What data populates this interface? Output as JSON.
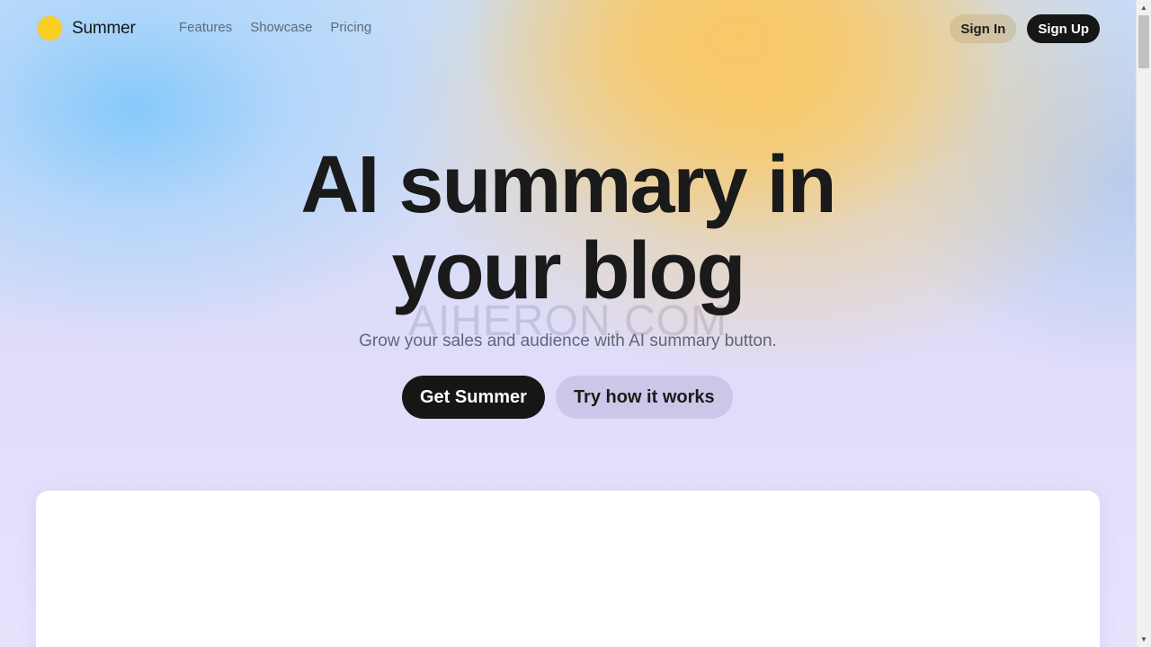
{
  "header": {
    "brand": "Summer",
    "nav": [
      {
        "label": "Features"
      },
      {
        "label": "Showcase"
      },
      {
        "label": "Pricing"
      }
    ],
    "sign_in_label": "Sign In",
    "sign_up_label": "Sign Up"
  },
  "hero": {
    "title_line1": "AI summary in",
    "title_line2": "your blog",
    "watermark": "AIHERON.COM",
    "subtitle": "Grow your sales and audience with AI summary button.",
    "primary_cta": "Get Summer",
    "secondary_cta": "Try how it works"
  },
  "colors": {
    "logo": "#f9cf24",
    "primary_button": "#161616",
    "text": "#1a1a1a"
  },
  "icons": {
    "logo": "sun-circle-icon",
    "scroll_up": "triangle-up-icon",
    "scroll_down": "triangle-down-icon"
  }
}
